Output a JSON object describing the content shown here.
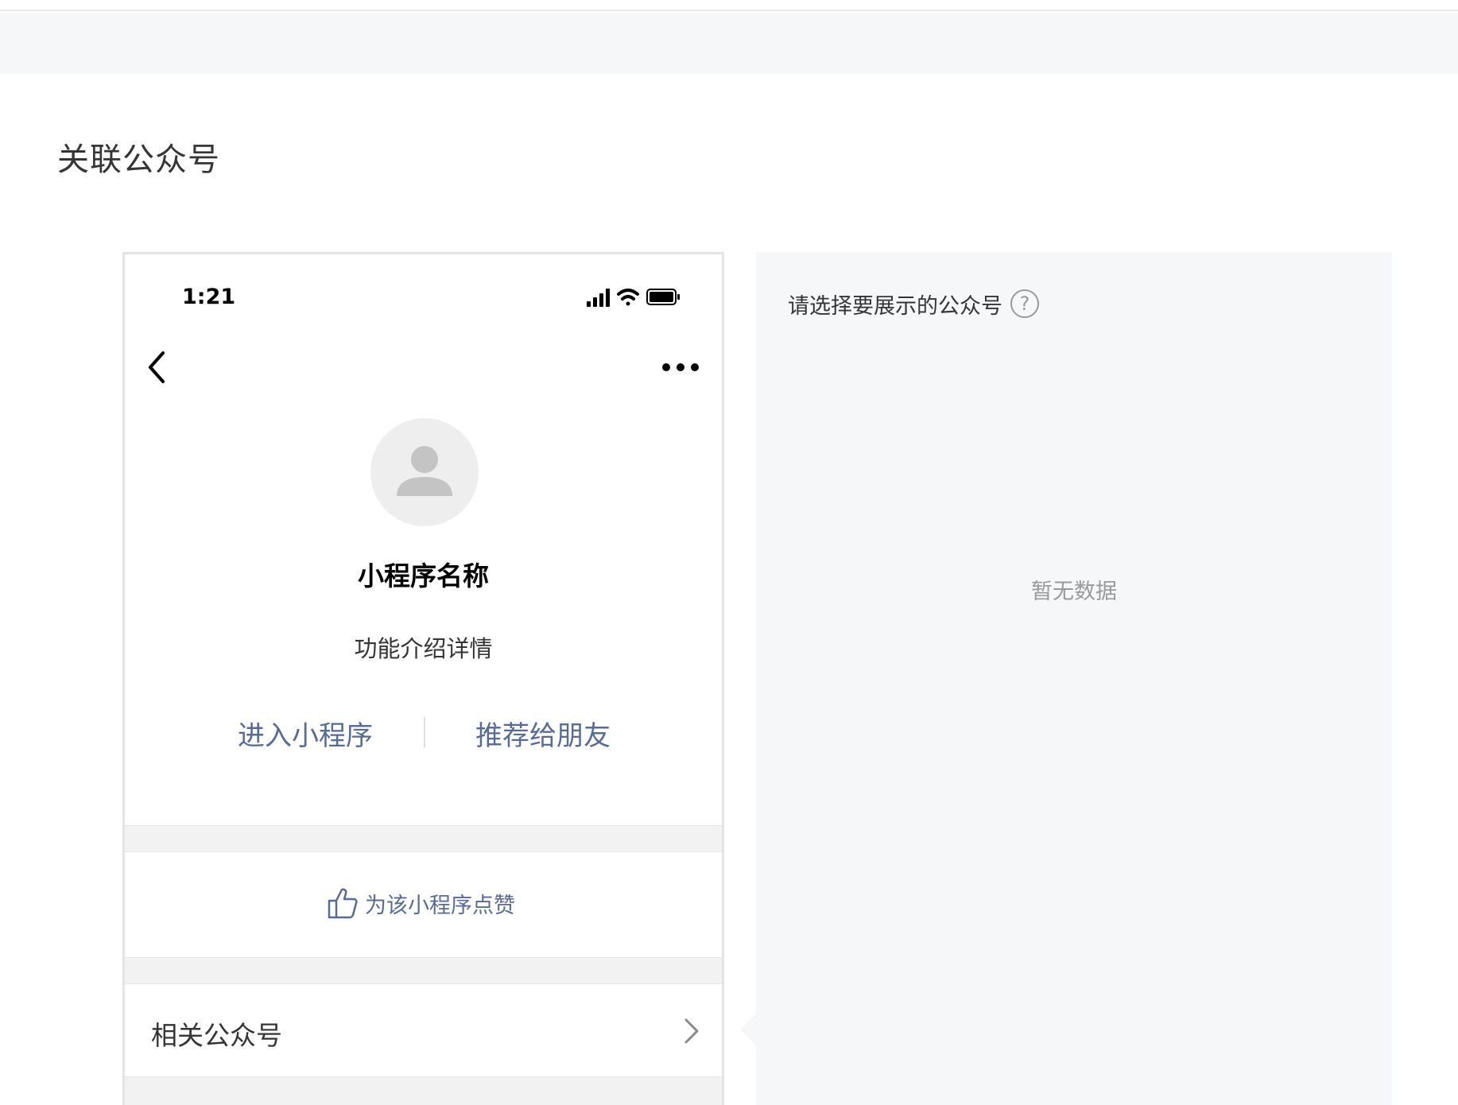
{
  "page": {
    "section_title": "关联公众号"
  },
  "phone": {
    "status_time": "1:21",
    "app_name": "小程序名称",
    "app_desc": "功能介绍详情",
    "action_enter": "进入小程序",
    "action_share": "推荐给朋友",
    "like_label": "为该小程序点赞",
    "related_label": "相关公众号",
    "link_color": "#576b95"
  },
  "panel": {
    "select_label": "请选择要展示的公众号",
    "help_symbol": "?",
    "empty_text": "暂无数据"
  }
}
